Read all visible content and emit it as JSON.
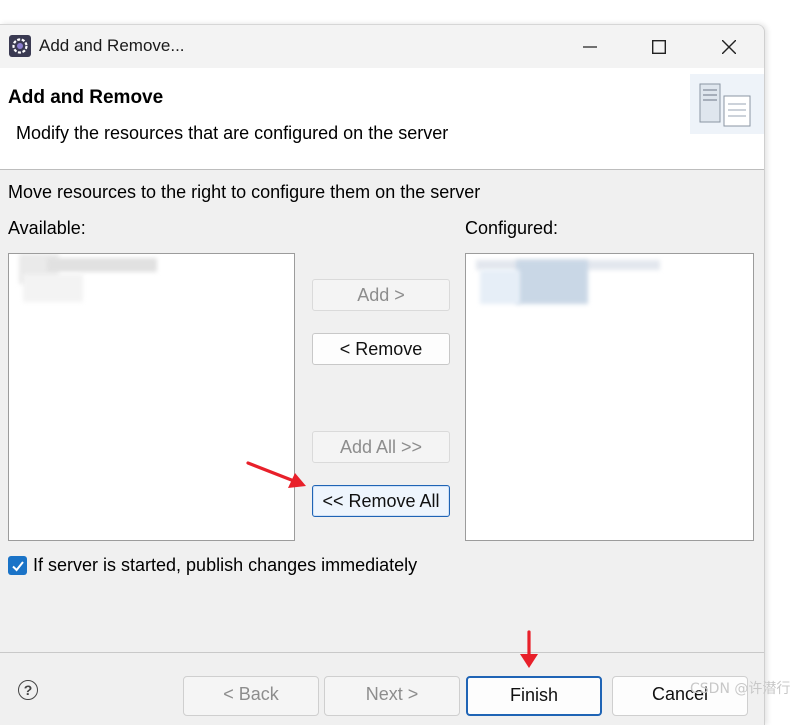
{
  "window": {
    "title": "Add and Remove...",
    "controls": {
      "minimize": "minimize-icon",
      "maximize": "maximize-icon",
      "close": "close-icon"
    }
  },
  "banner": {
    "title": "Add and Remove",
    "description": "Modify the resources that are configured on the server",
    "icon": "server-config-icon"
  },
  "instruction": "Move resources to the right to configure them on the server",
  "available": {
    "label": "Available:",
    "items": []
  },
  "configured": {
    "label": "Configured:",
    "items": []
  },
  "buttons": {
    "add": "Add >",
    "remove": "< Remove",
    "add_all": "Add All >>",
    "remove_all": "<< Remove All"
  },
  "publish_checkbox": {
    "label": "If server is started, publish changes immediately",
    "checked": true
  },
  "footer": {
    "help_icon": "help-icon",
    "back": "< Back",
    "next": "Next >",
    "finish": "Finish",
    "cancel": "Cancel"
  },
  "annotations": {
    "arrow_color": "#e8202a"
  },
  "watermark": "CSDN @许潜行",
  "colors": {
    "accent": "#1f64b5",
    "checkbox": "#1a73c7"
  }
}
